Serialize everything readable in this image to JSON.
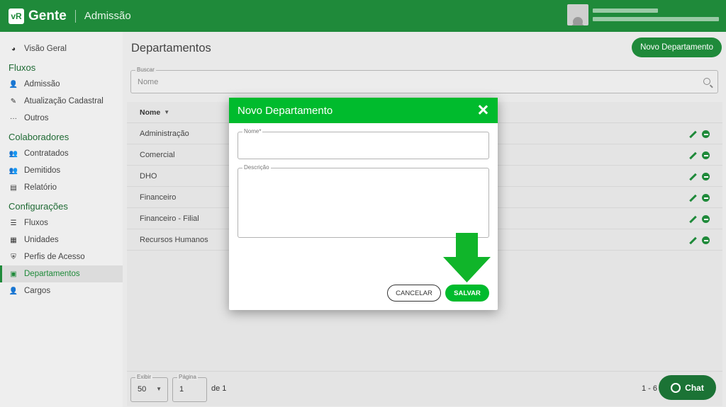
{
  "header": {
    "logo_mark": "vR",
    "app_name": "Gente",
    "module": "Admissão"
  },
  "sidebar": {
    "items_top": [
      {
        "label": "Visão Geral",
        "icon": "pie-chart-icon"
      }
    ],
    "sections": [
      {
        "title": "Fluxos",
        "items": [
          {
            "label": "Admissão",
            "icon": "user-add-icon"
          },
          {
            "label": "Atualização Cadastral",
            "icon": "user-edit-icon"
          },
          {
            "label": "Outros",
            "icon": "dots-icon"
          }
        ]
      },
      {
        "title": "Colaboradores",
        "items": [
          {
            "label": "Contratados",
            "icon": "user-list-icon"
          },
          {
            "label": "Demitidos",
            "icon": "user-list-icon"
          },
          {
            "label": "Relatório",
            "icon": "file-icon"
          }
        ]
      },
      {
        "title": "Configurações",
        "items": [
          {
            "label": "Fluxos",
            "icon": "list-icon"
          },
          {
            "label": "Unidades",
            "icon": "store-icon"
          },
          {
            "label": "Perfis de Acesso",
            "icon": "shield-icon"
          },
          {
            "label": "Departamentos",
            "icon": "id-card-icon",
            "active": true
          },
          {
            "label": "Cargos",
            "icon": "user-gear-icon"
          }
        ]
      }
    ]
  },
  "main": {
    "title": "Departamentos",
    "new_button": "Novo Departamento",
    "search": {
      "legend": "Buscar",
      "placeholder": "Nome"
    },
    "table": {
      "column": "Nome",
      "rows": [
        "Administração",
        "Comercial",
        "DHO",
        "Financeiro",
        "Financeiro - Filial",
        "Recursos Humanos"
      ]
    },
    "pagination": {
      "show_legend": "Exibir",
      "show_value": "50",
      "page_legend": "Página",
      "page_value": "1",
      "of_label": "de 1",
      "range": "1 - 6"
    }
  },
  "chat": {
    "label": "Chat"
  },
  "modal": {
    "title": "Novo Departamento",
    "name_legend": "Nome*",
    "desc_legend": "Descrição",
    "cancel": "CANCELAR",
    "save": "SALVAR"
  },
  "colors": {
    "brand": "#1f8a3a",
    "modal_green": "#00bb2d",
    "arrow": "#10b52a"
  }
}
